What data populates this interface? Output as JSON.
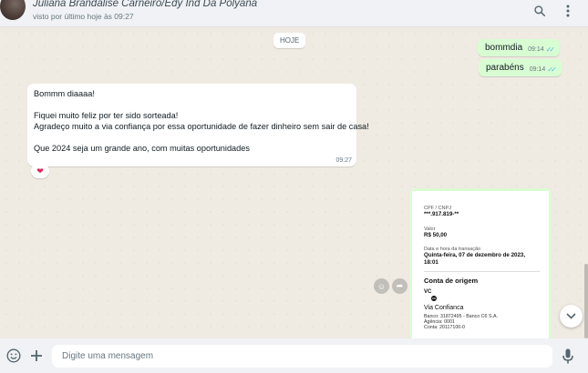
{
  "header": {
    "contact_name": "Juliana Brandalise Carneiro/Edy Ind Da Polyana",
    "last_seen": "visto por último hoje às 09:27",
    "icons": [
      "search-icon",
      "menu-dots-icon"
    ]
  },
  "chat": {
    "date_chip": "HOJE",
    "outgoing": [
      {
        "text": "bommdia",
        "time": "09:14"
      },
      {
        "text": "parabéns",
        "time": "09:14"
      }
    ],
    "incoming": {
      "lines": [
        "Bommm diaaaa!",
        "",
        "Fiquei muito feliz por ter sido sorteada!",
        "Agradeço muito a via confiança por essa oportunidade de fazer dinheiro sem sair de casa!",
        "",
        "Que 2024 seja um grande ano, com muitas oportunidades"
      ],
      "time": "09:27",
      "reaction": "❤"
    },
    "receipt": {
      "cpf_label": "CPF / CNPJ",
      "cpf_value": "***.917.819-**",
      "valor_label": "Valor",
      "valor_value": "R$ 50,00",
      "datetime_label": "Data e hora da transação",
      "datetime_value": "Quinta-feira, 07 de dezembro de 2023, 18:01",
      "section_title": "Conta de origem",
      "logo_text": "VC",
      "logo_badge": "C6",
      "bank_name": "Via Confianca",
      "banco": "Banco: 31872495 - Banco C6 S.A.",
      "agencia": "Agência: 0001",
      "conta": "Conta: 20117100-0"
    }
  },
  "footer": {
    "placeholder": "Digite uma mensagem",
    "icons": [
      "emoji-icon",
      "plus-icon",
      "mic-icon"
    ]
  },
  "colors": {
    "outgoing_bubble": "#d9fdd3",
    "incoming_bubble": "#ffffff",
    "chat_background": "#efeae2",
    "read_ticks": "#53bdeb"
  }
}
